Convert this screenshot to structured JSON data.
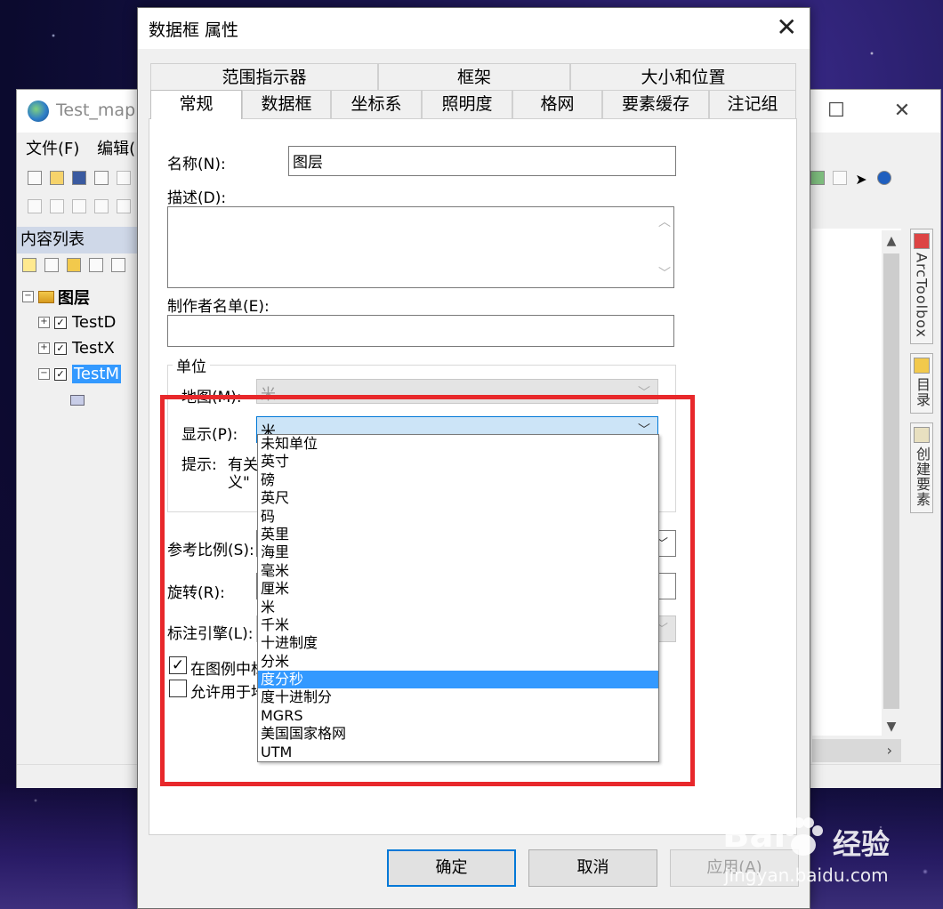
{
  "arcmap": {
    "title": "Test_map.",
    "menu": [
      "文件(F)",
      "编辑("
    ],
    "toc_header": "内容列表",
    "tree": {
      "root": "图层",
      "layers": [
        "TestD",
        "TestX",
        "TestM"
      ]
    },
    "side_tabs": [
      "ArcToolbox",
      "目录",
      "创建要素"
    ]
  },
  "dialog": {
    "title": "数据框 属性",
    "tabs_row1": [
      "范围指示器",
      "框架",
      "大小和位置"
    ],
    "tabs_row2": [
      "常规",
      "数据框",
      "坐标系",
      "照明度",
      "格网",
      "要素缓存",
      "注记组"
    ],
    "general": {
      "name_label": "名称(N):",
      "name_value": "图层",
      "desc_label": "描述(D):",
      "credits_label": "制作者名单(E):",
      "units_group": "单位",
      "map_label": "地图(M):",
      "map_value": "米",
      "display_label": "显示(P):",
      "display_value": "米",
      "hint_prefix": "提示:",
      "hint_line1": "有关",
      "hint_line2": "义\"",
      "ref_scale_label": "参考比例(S):",
      "rotation_label": "旋转(R):",
      "label_engine_label": "标注引擎(L):",
      "check1_label": "在图例中标",
      "check2_label": "允许用于地"
    },
    "dropdown_options": [
      "未知单位",
      "英寸",
      "磅",
      "英尺",
      "码",
      "英里",
      "海里",
      "毫米",
      "厘米",
      "米",
      "千米",
      "十进制度",
      "分米",
      "度分秒",
      "度十进制分",
      "MGRS",
      "美国国家格网",
      "UTM"
    ],
    "highlighted_option": "度分秒",
    "buttons": {
      "ok": "确定",
      "cancel": "取消",
      "apply": "应用(A)"
    }
  },
  "watermark": {
    "brand": "Bai",
    "brand_cn": "经验",
    "url": "jingyan.baidu.com"
  },
  "colors": {
    "highlight": "#3399ff",
    "focus_combo": "#cce4f7",
    "annotation_red": "#e8282b"
  }
}
